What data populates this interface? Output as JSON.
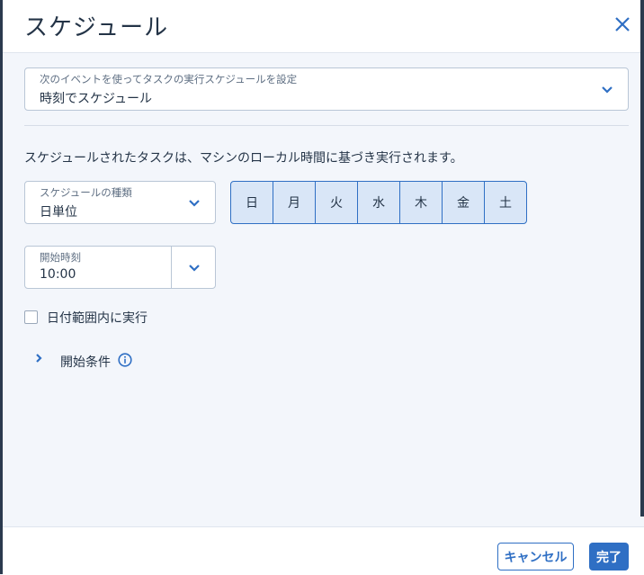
{
  "dialog": {
    "title": "スケジュール"
  },
  "schedule_mode": {
    "label": "次のイベントを使ってタスクの実行スケジュールを設定",
    "value": "時刻でスケジュール"
  },
  "info_text": "スケジュールされたタスクは、マシンのローカル時間に基づき実行されます。",
  "schedule_type": {
    "label": "スケジュールの種類",
    "value": "日単位"
  },
  "weekdays": [
    "日",
    "月",
    "火",
    "水",
    "木",
    "金",
    "土"
  ],
  "start_time": {
    "label": "開始時刻",
    "value": "10:00"
  },
  "date_range": {
    "label": "日付範囲内に実行",
    "checked": false
  },
  "start_conditions": {
    "label": "開始条件"
  },
  "footer": {
    "cancel_label": "キャンセル",
    "done_label": "完了"
  },
  "colors": {
    "accent": "#2f6fc4",
    "day_selected_bg": "#d9e6f7",
    "text": "#243447"
  }
}
